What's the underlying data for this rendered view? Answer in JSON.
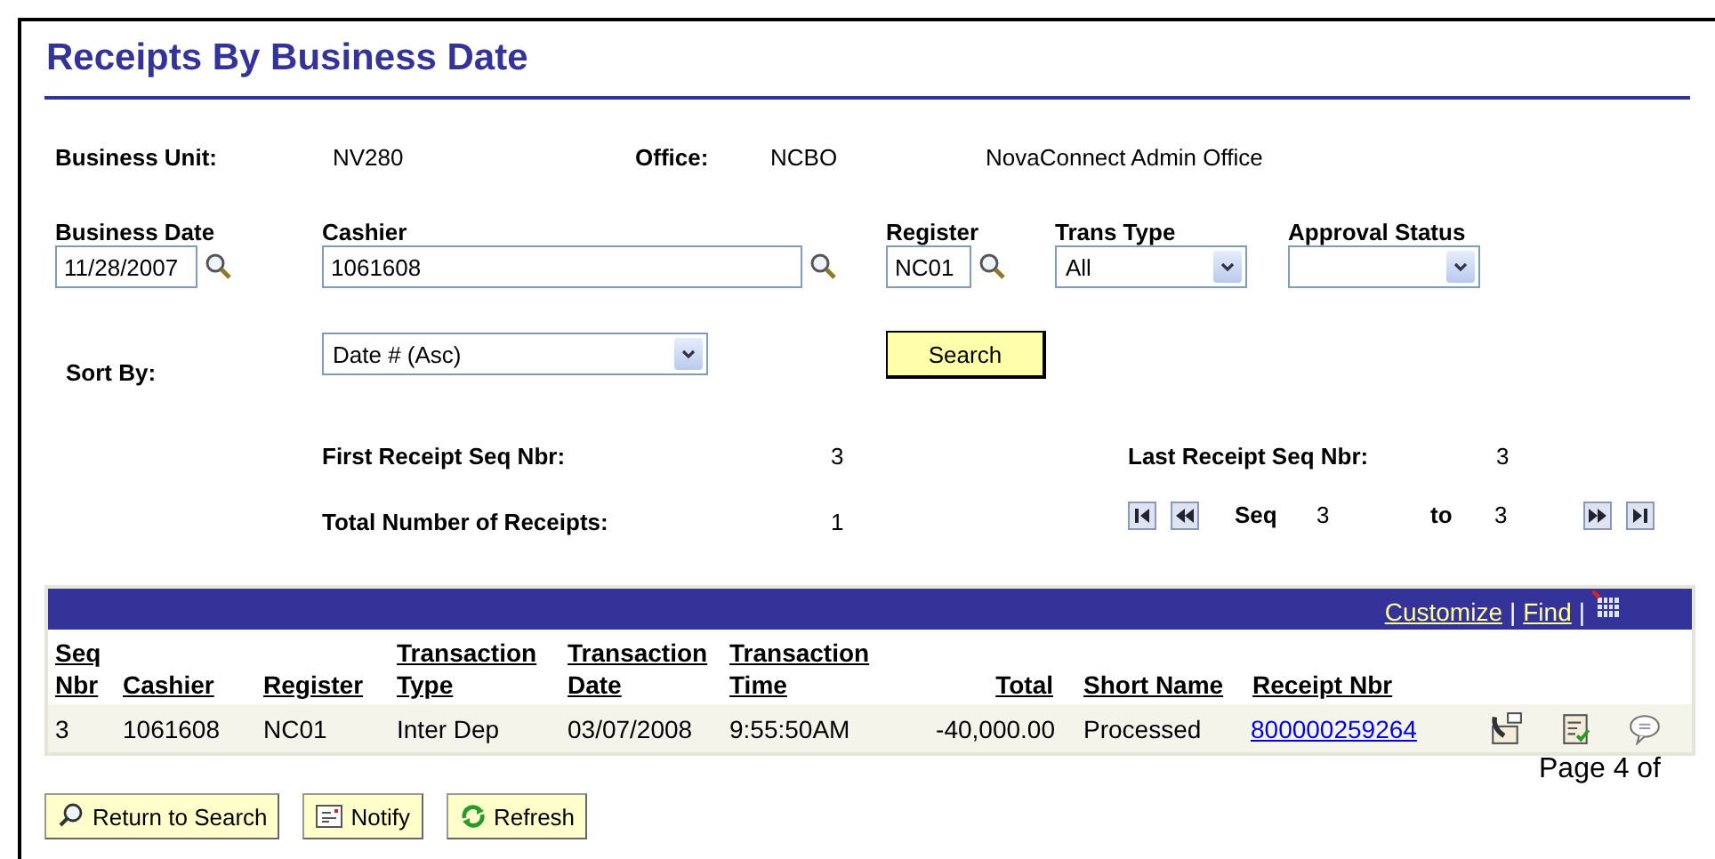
{
  "title": "Receipts By Business Date",
  "business_unit": {
    "label": "Business Unit:",
    "value": "NV280"
  },
  "office": {
    "label": "Office:",
    "code": "NCBO",
    "name": "NovaConnect Admin Office"
  },
  "filters": {
    "business_date": {
      "label": "Business Date",
      "value": "11/28/2007"
    },
    "cashier": {
      "label": "Cashier",
      "value": "1061608"
    },
    "register": {
      "label": "Register",
      "value": "NC01"
    },
    "trans_type": {
      "label": "Trans Type",
      "value": "All"
    },
    "approval_status": {
      "label": "Approval Status"
    },
    "sort_by": {
      "label": "Sort By:",
      "value": "Date # (Asc)"
    },
    "search_button": "Search"
  },
  "summary": {
    "first_seq": {
      "label": "First Receipt Seq Nbr:",
      "value": "3"
    },
    "last_seq": {
      "label": "Last Receipt Seq Nbr:",
      "value": "3"
    },
    "total_receipts": {
      "label": "Total Number of Receipts:",
      "value": "1"
    }
  },
  "navigation": {
    "seq_label": "Seq",
    "seq_from": "3",
    "to_label": "to",
    "seq_to": "3"
  },
  "grid": {
    "toolbar": [
      {
        "kind": "link",
        "text": "Customize"
      },
      {
        "kind": "sep",
        "text": "|"
      },
      {
        "kind": "link",
        "text": "Find"
      },
      {
        "kind": "sep",
        "text": "|"
      },
      {
        "kind": "icon"
      }
    ],
    "columns": [
      "Seq Nbr",
      "Cashier",
      "Register",
      "Transaction Type",
      "Transaction Date",
      "Transaction Time",
      "Total",
      "Short Name",
      "Receipt Nbr"
    ],
    "rows": [
      {
        "cells": [
          {
            "kind": "text",
            "text": "3"
          },
          {
            "kind": "text",
            "text": "1061608"
          },
          {
            "kind": "text",
            "text": "NC01"
          },
          {
            "kind": "text",
            "text": "Inter Dep"
          },
          {
            "kind": "text",
            "text": "03/07/2008"
          },
          {
            "kind": "text",
            "text": "9:55:50AM"
          },
          {
            "kind": "amount",
            "text": "-40,000.00"
          },
          {
            "kind": "text",
            "text": "Processed"
          },
          {
            "kind": "link",
            "text": "800000259264"
          }
        ]
      }
    ]
  },
  "page_indicator": "Page 4 of",
  "buttons": [
    {
      "kind": "return",
      "label": "Return to Search"
    },
    {
      "kind": "notify",
      "label": "Notify"
    },
    {
      "kind": "refresh",
      "label": "Refresh"
    }
  ]
}
